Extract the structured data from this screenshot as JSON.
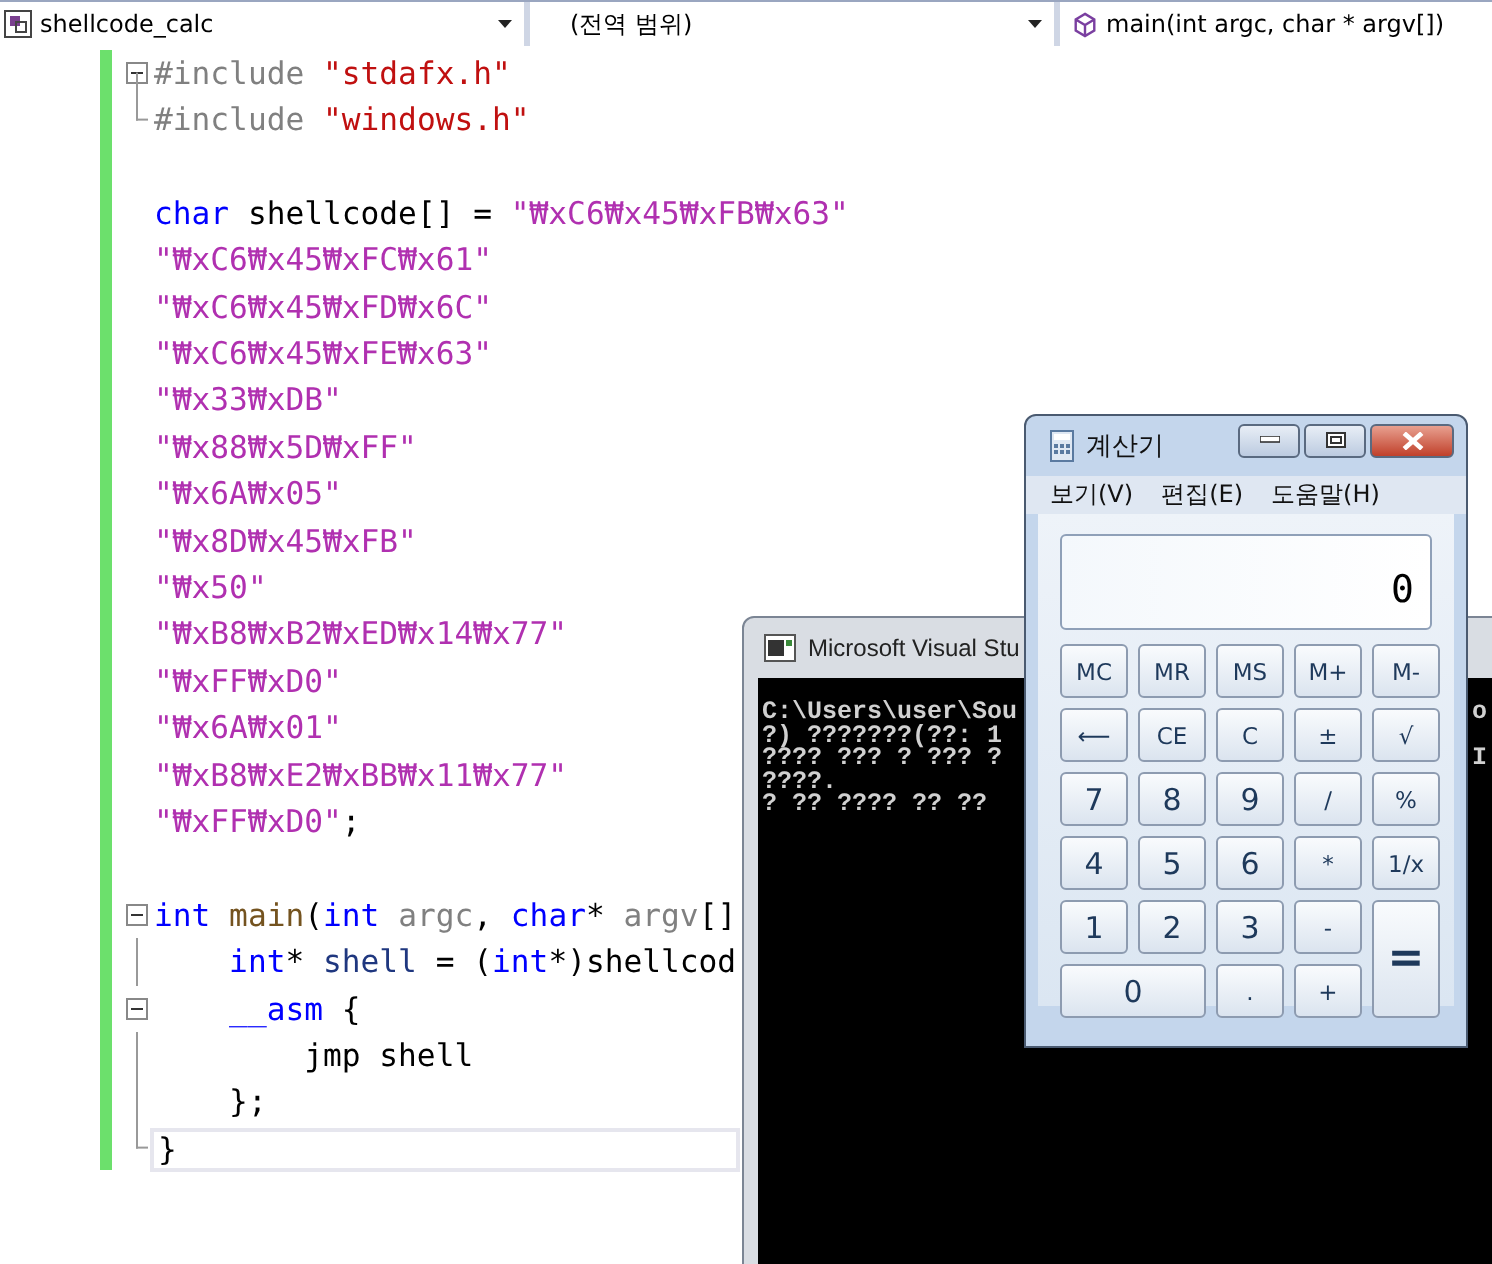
{
  "toolbar": {
    "project": "shellcode_calc",
    "scope": "(전역 범위)",
    "member": "main(int argc, char * argv[])"
  },
  "editor": {
    "lines": [
      {
        "kind": "fold-start",
        "current": false,
        "tokens": [
          {
            "kind": "directive",
            "text": "#include "
          },
          {
            "kind": "path",
            "text": "\"stdafx.h\""
          }
        ]
      },
      {
        "kind": "fold-end",
        "current": false,
        "tokens": [
          {
            "kind": "directive",
            "text": "#include "
          },
          {
            "kind": "path",
            "text": "\"windows.h\""
          }
        ]
      },
      {
        "kind": "plain",
        "current": false
      },
      {
        "kind": "plain",
        "current": false,
        "tokens": [
          {
            "kind": "keyword",
            "text": "char"
          },
          {
            "kind": "plain",
            "text": " shellcode[] = "
          },
          {
            "kind": "string",
            "text": "\"₩xC6₩x45₩xFB₩x63\""
          }
        ]
      },
      {
        "kind": "plain",
        "current": false,
        "tokens": [
          {
            "kind": "string",
            "text": "\"₩xC6₩x45₩xFC₩x61\""
          }
        ]
      },
      {
        "kind": "plain",
        "current": false,
        "tokens": [
          {
            "kind": "string",
            "text": "\"₩xC6₩x45₩xFD₩x6C\""
          }
        ]
      },
      {
        "kind": "plain",
        "current": false,
        "tokens": [
          {
            "kind": "string",
            "text": "\"₩xC6₩x45₩xFE₩x63\""
          }
        ]
      },
      {
        "kind": "plain",
        "current": false,
        "tokens": [
          {
            "kind": "string",
            "text": "\"₩x33₩xDB\""
          }
        ]
      },
      {
        "kind": "plain",
        "current": false,
        "tokens": [
          {
            "kind": "string",
            "text": "\"₩x88₩x5D₩xFF\""
          }
        ]
      },
      {
        "kind": "plain",
        "current": false,
        "tokens": [
          {
            "kind": "string",
            "text": "\"₩x6A₩x05\""
          }
        ]
      },
      {
        "kind": "plain",
        "current": false,
        "tokens": [
          {
            "kind": "string",
            "text": "\"₩x8D₩x45₩xFB\""
          }
        ]
      },
      {
        "kind": "plain",
        "current": false,
        "tokens": [
          {
            "kind": "string",
            "text": "\"₩x50\""
          }
        ]
      },
      {
        "kind": "plain",
        "current": false,
        "tokens": [
          {
            "kind": "string",
            "text": "\"₩xB8₩xB2₩xED₩x14₩x77\""
          }
        ]
      },
      {
        "kind": "plain",
        "current": false,
        "tokens": [
          {
            "kind": "string",
            "text": "\"₩xFF₩xD0\""
          }
        ]
      },
      {
        "kind": "plain",
        "current": false,
        "tokens": [
          {
            "kind": "string",
            "text": "\"₩x6A₩x01\""
          }
        ]
      },
      {
        "kind": "plain",
        "current": false,
        "tokens": [
          {
            "kind": "string",
            "text": "\"₩xB8₩xE2₩xBB₩x11₩x77\""
          }
        ]
      },
      {
        "kind": "plain",
        "current": false,
        "tokens": [
          {
            "kind": "string",
            "text": "\"₩xFF₩xD0\""
          },
          {
            "kind": "plain",
            "text": ";"
          }
        ]
      },
      {
        "kind": "plain",
        "current": false
      },
      {
        "kind": "fold-start",
        "current": false,
        "tokens": [
          {
            "kind": "keyword",
            "text": "int"
          },
          {
            "kind": "function",
            "text": " main"
          },
          {
            "kind": "plain",
            "text": "("
          },
          {
            "kind": "keyword",
            "text": "int"
          },
          {
            "kind": "param",
            "text": " argc"
          },
          {
            "kind": "plain",
            "text": ", "
          },
          {
            "kind": "keyword",
            "text": "char"
          },
          {
            "kind": "plain",
            "text": "* "
          },
          {
            "kind": "param",
            "text": "argv"
          },
          {
            "kind": "plain",
            "text": "[]"
          }
        ]
      },
      {
        "kind": "fold-body",
        "current": false,
        "tokens": [
          {
            "kind": "keyword",
            "text": "    int"
          },
          {
            "kind": "plain",
            "text": "* "
          },
          {
            "kind": "variable",
            "text": "shell"
          },
          {
            "kind": "plain",
            "text": " = ("
          },
          {
            "kind": "keyword",
            "text": "int"
          },
          {
            "kind": "plain",
            "text": "*)shellcod"
          }
        ]
      },
      {
        "kind": "fold-start",
        "current": false,
        "tokens": [
          {
            "kind": "keyword",
            "text": "    __asm"
          },
          {
            "kind": "plain",
            "text": " {"
          }
        ]
      },
      {
        "kind": "fold-body",
        "current": false,
        "tokens": [
          {
            "kind": "plain",
            "text": "        jmp shell"
          }
        ]
      },
      {
        "kind": "fold-body",
        "current": false,
        "tokens": [
          {
            "kind": "plain",
            "text": "    };"
          }
        ]
      },
      {
        "kind": "fold-end",
        "current": true,
        "tokens": [
          {
            "kind": "plain",
            "text": "}"
          }
        ]
      }
    ]
  },
  "console": {
    "title": "Microsoft Visual Stu",
    "lines": [
      {
        "text": "C:\\Users\\user\\Sou",
        "tail": "o"
      },
      {
        "text": "?) ???????(??: 1"
      },
      {
        "text": "???? ??? ? ??? ?",
        "tail": "I"
      },
      {
        "text": "????."
      },
      {
        "text": "? ?? ???? ?? ??"
      }
    ]
  },
  "calculator": {
    "title": "계산기",
    "menu": [
      "보기(V)",
      "편집(E)",
      "도움말(H)"
    ],
    "display": "0",
    "keys": [
      {
        "label": "MC",
        "kind": "small"
      },
      {
        "label": "MR",
        "kind": "small"
      },
      {
        "label": "MS",
        "kind": "small"
      },
      {
        "label": "M+",
        "kind": "small"
      },
      {
        "label": "M-",
        "kind": "small"
      },
      {
        "label": "⟵",
        "kind": "small"
      },
      {
        "label": "CE",
        "kind": "small"
      },
      {
        "label": "C",
        "kind": "small"
      },
      {
        "label": "±",
        "kind": "small"
      },
      {
        "label": "√",
        "kind": "small"
      },
      {
        "label": "7",
        "kind": "digit"
      },
      {
        "label": "8",
        "kind": "digit"
      },
      {
        "label": "9",
        "kind": "digit"
      },
      {
        "label": "/",
        "kind": "small"
      },
      {
        "label": "%",
        "kind": "small"
      },
      {
        "label": "4",
        "kind": "digit"
      },
      {
        "label": "5",
        "kind": "digit"
      },
      {
        "label": "6",
        "kind": "digit"
      },
      {
        "label": "*",
        "kind": "small"
      },
      {
        "label": "1/x",
        "kind": "small"
      },
      {
        "label": "1",
        "kind": "digit"
      },
      {
        "label": "2",
        "kind": "digit"
      },
      {
        "label": "3",
        "kind": "digit"
      },
      {
        "label": "-",
        "kind": "small"
      },
      {
        "label": "=",
        "kind": "tall"
      },
      {
        "label": "0",
        "kind": "wide"
      },
      {
        "label": ".",
        "kind": "small"
      },
      {
        "label": "+",
        "kind": "small"
      }
    ]
  }
}
